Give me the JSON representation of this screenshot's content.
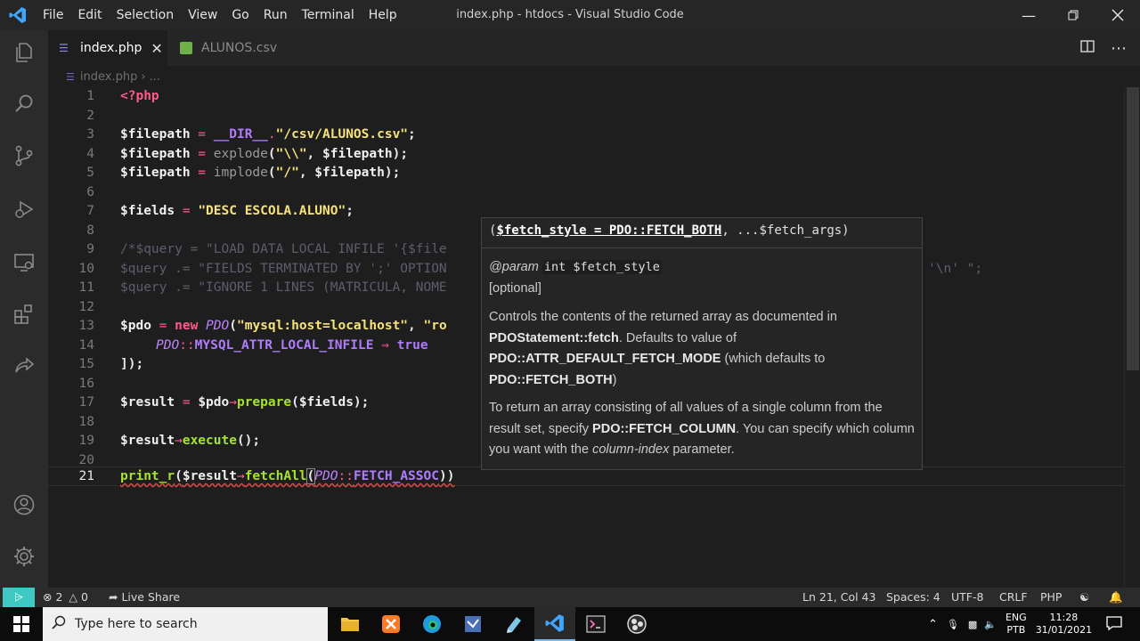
{
  "window": {
    "title": "index.php - htdocs - Visual Studio Code"
  },
  "menu": [
    "File",
    "Edit",
    "Selection",
    "View",
    "Go",
    "Run",
    "Terminal",
    "Help"
  ],
  "tabs": [
    {
      "label": "index.php",
      "active": true
    },
    {
      "label": "ALUNOS.csv",
      "active": false
    }
  ],
  "breadcrumb": {
    "file": "index.php",
    "sep": "›",
    "more": "..."
  },
  "editor": {
    "lines": [
      {
        "n": "1"
      },
      {
        "n": "2"
      },
      {
        "n": "3"
      },
      {
        "n": "4"
      },
      {
        "n": "5"
      },
      {
        "n": "6"
      },
      {
        "n": "7"
      },
      {
        "n": "8"
      },
      {
        "n": "9"
      },
      {
        "n": "10"
      },
      {
        "n": "11"
      },
      {
        "n": "12"
      },
      {
        "n": "13"
      },
      {
        "n": "14"
      },
      {
        "n": "15"
      },
      {
        "n": "16"
      },
      {
        "n": "17"
      },
      {
        "n": "18"
      },
      {
        "n": "19"
      },
      {
        "n": "20"
      },
      {
        "n": "21"
      }
    ],
    "code": {
      "l1": "<?php",
      "l3_var": "$filepath",
      "l3_eq": " = ",
      "l3_const": "__DIR__",
      "l3_dot": ".",
      "l3_str": "\"/csv/ALUNOS.csv\"",
      "l3_end": ";",
      "l4_var": "$filepath",
      "l4_eq": " = ",
      "l4_fn": "explode",
      "l4_open": "(",
      "l4_str": "\"\\\\\"",
      "l4_mid": ", ",
      "l4_var2": "$filepath",
      "l4_end": ");",
      "l5_var": "$filepath",
      "l5_eq": " = ",
      "l5_fn": "implode",
      "l5_open": "(",
      "l5_str": "\"/\"",
      "l5_mid": ", ",
      "l5_var2": "$filepath",
      "l5_end": ");",
      "l7_var": "$fields",
      "l7_eq": " = ",
      "l7_str": "\"DESC ESCOLA.ALUNO\"",
      "l7_end": ";",
      "l9": "/*$query = \"LOAD DATA LOCAL INFILE '{$file",
      "l10": "$query .= \"FIELDS TERMINATED BY ';' OPTION",
      "l10_tail": "'\\n' \";",
      "l11": "$query .= \"IGNORE 1 LINES (MATRICULA, NOME",
      "l13_var": "$pdo",
      "l13_eq": " = ",
      "l13_new": "new ",
      "l13_cls": "PDO",
      "l13_open": "(",
      "l13_str": "\"mysql:host=localhost\"",
      "l13_mid": ", ",
      "l13_str2": "\"ro",
      "l14_cls": "PDO",
      "l14_sep": "::",
      "l14_const": "MYSQL_ATTR_LOCAL_INFILE",
      "l14_arrow": " ⇒ ",
      "l14_bool": "true",
      "l15": "]);",
      "l17_var": "$result",
      "l17_eq": " = ",
      "l17_var2": "$pdo",
      "l17_arrow": "→",
      "l17_fn": "prepare",
      "l17_open": "(",
      "l17_var3": "$fields",
      "l17_end": ");",
      "l19_var": "$result",
      "l19_arrow": "→",
      "l19_fn": "execute",
      "l19_end": "();",
      "l21_fn": "print_r",
      "l21_open": "(",
      "l21_var": "$result",
      "l21_arrow": "→",
      "l21_fn2": "fetchAll",
      "l21_open2": "(",
      "l21_cls": "PDO",
      "l21_sep": "::",
      "l21_const": "FETCH_ASSOC",
      "l21_end": "))"
    }
  },
  "hover": {
    "sig_open": "(",
    "sig_param": "$fetch_style = PDO::FETCH_BOTH",
    "sig_rest": ", ...$fetch_args)",
    "param_tag": "@param",
    "param_code": "int $fetch_style",
    "optional": "[optional]",
    "p1_a": "Controls the contents of the returned array as documented in ",
    "p1_b": "PDOStatement::fetch",
    "p1_c": ". Defaults to value of ",
    "p1_d": "PDO::ATTR_DEFAULT_FETCH_MODE",
    "p1_e": " (which defaults to ",
    "p1_f": "PDO::FETCH_BOTH",
    "p1_g": ")",
    "p2_a": "To return an array consisting of all values of a single column from the result set, specify ",
    "p2_b": "PDO::FETCH_COLUMN",
    "p2_c": ". You can specify which column you want with the ",
    "p2_d": "column-index",
    "p2_e": " parameter."
  },
  "status": {
    "errors": "2",
    "warnings": "0",
    "live_share": "Live Share",
    "position": "Ln 21, Col 43",
    "spaces": "Spaces: 4",
    "encoding": "UTF-8",
    "eol": "CRLF",
    "language": "PHP"
  },
  "taskbar": {
    "search_placeholder": "Type here to search",
    "lang_top": "ENG",
    "lang_bottom": "PTB",
    "time": "11:28",
    "date": "31/01/2021"
  },
  "colors": {
    "accent_remote": "#3ec9c3",
    "keyword_pink": "#ff5a8c",
    "string_yellow": "#f7e27a",
    "function_green": "#a6e22e",
    "class_purple": "#c084ff"
  }
}
